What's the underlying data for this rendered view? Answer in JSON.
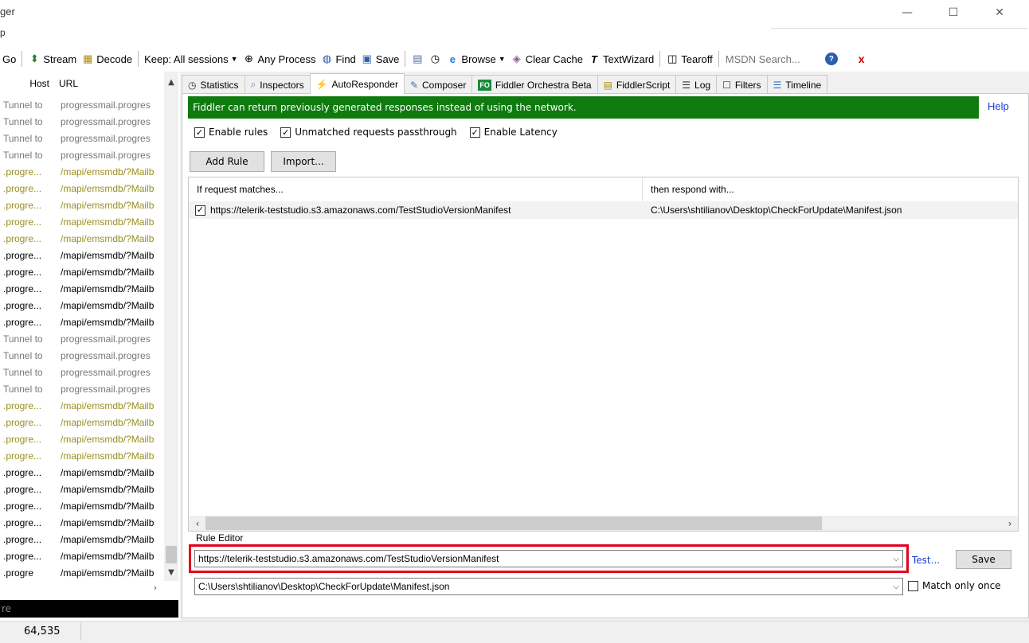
{
  "window": {
    "title_fragment": "ger",
    "menu_fragment": "p",
    "controls": {
      "minimize": "—",
      "maximize": "☐",
      "close": "✕"
    }
  },
  "toolbar": {
    "go": "Go",
    "stream": "Stream",
    "decode": "Decode",
    "keep": "Keep: All sessions",
    "process": "Any Process",
    "find": "Find",
    "save": "Save",
    "browse": "Browse",
    "clear_cache": "Clear Cache",
    "textwizard": "TextWizard",
    "tearoff": "Tearoff",
    "msdn_placeholder": "MSDN Search...",
    "close_x": "x"
  },
  "sessions": {
    "headers": {
      "host": "Host",
      "url": "URL"
    },
    "rows": [
      {
        "host": "Tunnel to",
        "url": "progressmail.progres",
        "style": "gray"
      },
      {
        "host": "Tunnel to",
        "url": "progressmail.progres",
        "style": "gray"
      },
      {
        "host": "Tunnel to",
        "url": "progressmail.progres",
        "style": "gray"
      },
      {
        "host": "Tunnel to",
        "url": "progressmail.progres",
        "style": "gray"
      },
      {
        "host": ".progre...",
        "url": "/mapi/emsmdb/?Mailb",
        "style": "olive"
      },
      {
        "host": ".progre...",
        "url": "/mapi/emsmdb/?Mailb",
        "style": "olive"
      },
      {
        "host": ".progre...",
        "url": "/mapi/emsmdb/?Mailb",
        "style": "olive"
      },
      {
        "host": ".progre...",
        "url": "/mapi/emsmdb/?Mailb",
        "style": "olive"
      },
      {
        "host": ".progre...",
        "url": "/mapi/emsmdb/?Mailb",
        "style": "olive"
      },
      {
        "host": ".progre...",
        "url": "/mapi/emsmdb/?Mailb",
        "style": "black"
      },
      {
        "host": ".progre...",
        "url": "/mapi/emsmdb/?Mailb",
        "style": "black"
      },
      {
        "host": ".progre...",
        "url": "/mapi/emsmdb/?Mailb",
        "style": "black"
      },
      {
        "host": ".progre...",
        "url": "/mapi/emsmdb/?Mailb",
        "style": "black"
      },
      {
        "host": ".progre...",
        "url": "/mapi/emsmdb/?Mailb",
        "style": "black"
      },
      {
        "host": "Tunnel to",
        "url": "progressmail.progres",
        "style": "gray"
      },
      {
        "host": "Tunnel to",
        "url": "progressmail.progres",
        "style": "gray"
      },
      {
        "host": "Tunnel to",
        "url": "progressmail.progres",
        "style": "gray"
      },
      {
        "host": "Tunnel to",
        "url": "progressmail.progres",
        "style": "gray"
      },
      {
        "host": ".progre...",
        "url": "/mapi/emsmdb/?Mailb",
        "style": "olive"
      },
      {
        "host": ".progre...",
        "url": "/mapi/emsmdb/?Mailb",
        "style": "olive"
      },
      {
        "host": ".progre...",
        "url": "/mapi/emsmdb/?Mailb",
        "style": "olive"
      },
      {
        "host": ".progre...",
        "url": "/mapi/emsmdb/?Mailb",
        "style": "olive"
      },
      {
        "host": ".progre...",
        "url": "/mapi/emsmdb/?Mailb",
        "style": "black"
      },
      {
        "host": ".progre...",
        "url": "/mapi/emsmdb/?Mailb",
        "style": "black"
      },
      {
        "host": ".progre...",
        "url": "/mapi/emsmdb/?Mailb",
        "style": "black"
      },
      {
        "host": ".progre...",
        "url": "/mapi/emsmdb/?Mailb",
        "style": "black"
      },
      {
        "host": ".progre...",
        "url": "/mapi/emsmdb/?Mailb",
        "style": "black"
      },
      {
        "host": ".progre...",
        "url": "/mapi/emsmdb/?Mailb",
        "style": "black"
      },
      {
        "host": ".progre",
        "url": "/mapi/emsmdb/?Mailb",
        "style": "black"
      }
    ],
    "quickexec_fragment": "re"
  },
  "status": {
    "count": "64,535"
  },
  "tabs": [
    {
      "label": "Statistics",
      "icon": "stopwatch-icon"
    },
    {
      "label": "Inspectors",
      "icon": "magnifier-icon"
    },
    {
      "label": "AutoResponder",
      "icon": "lightning-icon",
      "active": true
    },
    {
      "label": "Composer",
      "icon": "pencil-icon"
    },
    {
      "label": "Fiddler Orchestra Beta",
      "icon": "fo-icon",
      "badge": "FO"
    },
    {
      "label": "FiddlerScript",
      "icon": "script-icon"
    },
    {
      "label": "Log",
      "icon": "log-icon"
    },
    {
      "label": "Filters",
      "icon": "checkbox-icon"
    },
    {
      "label": "Timeline",
      "icon": "timeline-icon"
    }
  ],
  "autoresponder": {
    "banner": "Fiddler can return previously generated responses instead of using the network.",
    "help": "Help",
    "options": [
      {
        "label": "Enable rules",
        "checked": true
      },
      {
        "label": "Unmatched requests passthrough",
        "checked": true
      },
      {
        "label": "Enable Latency",
        "checked": true
      }
    ],
    "add_rule": "Add Rule",
    "import": "Import...",
    "columns": {
      "match": "If request matches...",
      "respond": "then respond with..."
    },
    "rules": [
      {
        "checked": true,
        "match": "https://telerik-teststudio.s3.amazonaws.com/TestStudioVersionManifest",
        "respond": "C:\\Users\\shtilianov\\Desktop\\CheckForUpdate\\Manifest.json"
      }
    ],
    "rule_editor": {
      "label": "Rule Editor",
      "match_value": "https://telerik-teststudio.s3.amazonaws.com/TestStudioVersionManifest",
      "respond_value": "C:\\Users\\shtilianov\\Desktop\\CheckForUpdate\\Manifest.json",
      "test": "Test...",
      "save": "Save",
      "match_once": "Match only once",
      "match_once_checked": false
    }
  },
  "colors": {
    "banner_bg": "#0f7b0f",
    "link": "#1a3fd1",
    "highlight_box": "#e3001b"
  }
}
